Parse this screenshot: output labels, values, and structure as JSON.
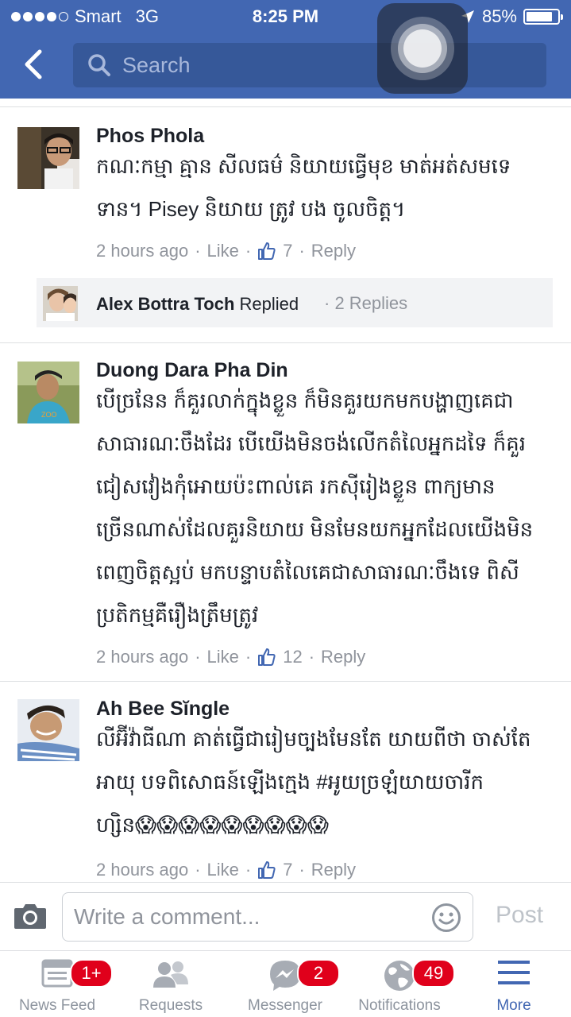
{
  "status_bar": {
    "carrier": "Smart",
    "network": "3G",
    "time": "8:25 PM",
    "battery_percent": "85%",
    "battery_level": 0.85
  },
  "header": {
    "search_placeholder": "Search"
  },
  "comments": [
    {
      "name": "Phos Phola",
      "lines": [
        "កណៈកម្មា គ្មាន សីលធម៌ និយាយធ្វើមុខ មាត់អត់សមទេ",
        "ទាន។ Pisey និយាយ ត្រូវ បង ចូលចិត្ត។"
      ],
      "time": "2 hours ago",
      "like_label": "Like",
      "like_count": "7",
      "reply_label": "Reply"
    },
    {
      "name": "Duong Dara Pha Din",
      "lines": [
        "បើច្រនែន ក៏គួរលាក់ក្នុងខ្លួន ក៏មិនគួរយកមកបង្ហាញគេជា",
        "សាធារណៈចឹងដែរ បើយើងមិនចង់លើកតំលៃអ្នកដទៃ ក៏គួរ",
        "ជៀសវៀងកុំអោយប៉ះពាល់គេ រកស៊ីរៀងខ្លួន  ពាក្យមាន",
        "ច្រើនណាស់ដែលគួរនិយាយ មិនមែនយកអ្នកដែលយើងមិន",
        "ពេញចិត្តស្អប់ មកបន្ទាបតំលៃគេជាសាធារណៈចឹងទេ  ពិសី",
        "ប្រតិកម្មគឺរឿងត្រឹមត្រូវ"
      ],
      "time": "2 hours ago",
      "like_label": "Like",
      "like_count": "12",
      "reply_label": "Reply"
    },
    {
      "name": "Ah Bee Sĭngle",
      "lines": [
        "លីអ៊ីវ៉ាធីណា គាត់ធ្វើជារៀមច្បងមែនតែ យាយពីថា ចាស់តែ",
        "អាយុ បទពិសោធន៍ឡើងក្មេង #អូយច្រឡំយាយចារីក",
        "ហ្សិន😱😱😱😱😱😱😱😱😱"
      ],
      "time": "2 hours ago",
      "like_label": "Like",
      "like_count": "7",
      "reply_label": "Reply"
    }
  ],
  "reply_summary": {
    "name": "Alex Bottra Toch",
    "action": "Replied",
    "count": "· 2 Replies"
  },
  "composer": {
    "placeholder": "Write a comment...",
    "post_label": "Post"
  },
  "tabs": [
    {
      "label": "News Feed",
      "icon": "news-feed-icon",
      "badge": "1+"
    },
    {
      "label": "Requests",
      "icon": "requests-icon",
      "badge": ""
    },
    {
      "label": "Messenger",
      "icon": "messenger-icon",
      "badge": "2"
    },
    {
      "label": "Notifications",
      "icon": "globe-icon",
      "badge": "49"
    },
    {
      "label": "More",
      "icon": "menu-icon",
      "badge": ""
    }
  ],
  "colors": {
    "brand": "#4267b2",
    "badge": "#e0001b",
    "meta_text": "#90949c"
  }
}
